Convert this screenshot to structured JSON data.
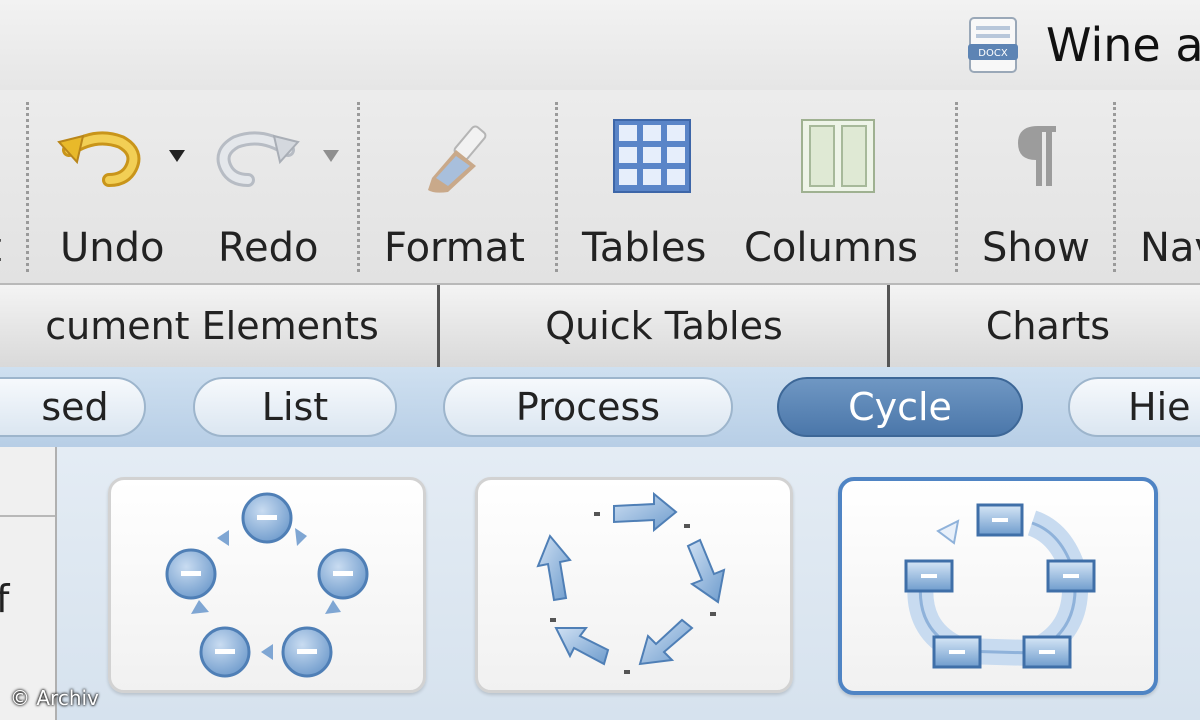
{
  "window": {
    "title": "Wine a",
    "doc_icon_label": "DOCX"
  },
  "toolbar": {
    "partial_left_label": "t",
    "undo_label": "Undo",
    "redo_label": "Redo",
    "format_label": "Format",
    "tables_label": "Tables",
    "columns_label": "Columns",
    "show_label": "Show",
    "nav_label": "Nav"
  },
  "ribbon": {
    "tabs": [
      "cument Elements",
      "Quick Tables",
      "Charts"
    ]
  },
  "categories": {
    "items": [
      "sed",
      "List",
      "Process",
      "Cycle",
      "Hie"
    ],
    "active": "Cycle"
  },
  "sidepanel": {
    "partial_text": "f"
  },
  "gallery": {
    "items": [
      "basic-cycle",
      "arrow-cycle",
      "segmented-cycle"
    ],
    "selected": "segmented-cycle"
  },
  "watermark": "© Archiv",
  "colors": {
    "active_pill": "#4b77aa",
    "selection_border": "#4f84c4",
    "undo_icon": "#e8b92a"
  }
}
